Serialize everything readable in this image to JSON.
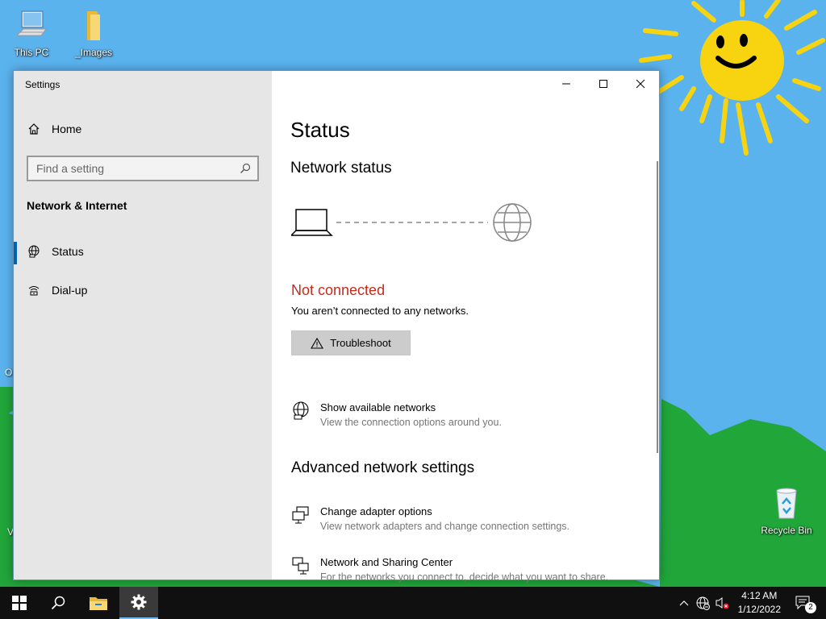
{
  "desktop": {
    "icons": {
      "this_pc": "This PC",
      "images": "_Images",
      "recycle_bin": "Recycle Bin"
    },
    "partial_left_labels": [
      "O",
      "V"
    ]
  },
  "window": {
    "title": "Settings",
    "minimize_icon": "minimize-icon",
    "maximize_icon": "maximize-icon",
    "close_icon": "close-icon"
  },
  "sidebar": {
    "home_label": "Home",
    "search_placeholder": "Find a setting",
    "section_heading": "Network & Internet",
    "items": [
      {
        "label": "Status",
        "icon": "globe-network-icon",
        "active": true
      },
      {
        "label": "Dial-up",
        "icon": "dial-up-icon",
        "active": false
      }
    ]
  },
  "main": {
    "page_title": "Status",
    "network_status_heading": "Network status",
    "connection_state": "Not connected",
    "connection_detail": "You aren’t connected to any networks.",
    "troubleshoot_label": "Troubleshoot",
    "links": [
      {
        "title": "Show available networks",
        "subtitle": "View the connection options around you.",
        "icon": "network-globe-icon"
      }
    ],
    "advanced_heading": "Advanced network settings",
    "advanced_links": [
      {
        "title": "Change adapter options",
        "subtitle": "View network adapters and change connection settings.",
        "icon": "adapter-icon"
      },
      {
        "title": "Network and Sharing Center",
        "subtitle": "For the networks you connect to, decide what you want to share.",
        "icon": "sharing-center-icon"
      }
    ]
  },
  "taskbar": {
    "time": "4:12 AM",
    "date": "1/12/2022",
    "notification_count": "2"
  },
  "colors": {
    "accent": "#0063b1",
    "error_red": "#c42b1c",
    "sidebar_bg": "#e6e6e6",
    "taskbar_bg": "#101010",
    "sky": "#5bb3ee",
    "hill": "#21a63a",
    "sun": "#f7d40f"
  }
}
